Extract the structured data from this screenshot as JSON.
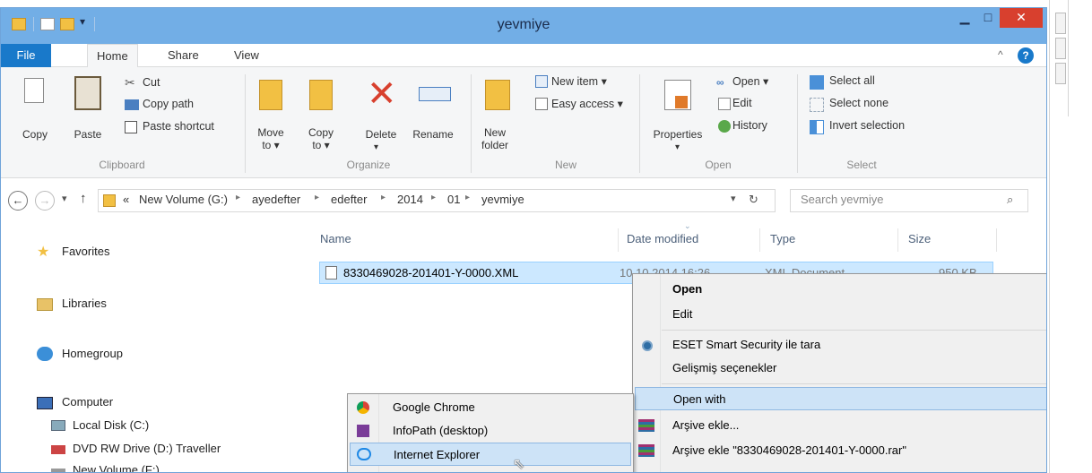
{
  "window": {
    "title": "yevmiye"
  },
  "tabs": [
    "File",
    "Home",
    "Share",
    "View"
  ],
  "ribbon": {
    "clipboard": {
      "group": "Clipboard",
      "copy": "Copy",
      "paste": "Paste",
      "cut": "Cut",
      "copy_path": "Copy path",
      "paste_shortcut": "Paste shortcut"
    },
    "organize": {
      "group": "Organize",
      "move_to_1": "Move",
      "move_to_2": "to ▾",
      "copy_to_1": "Copy",
      "copy_to_2": "to ▾",
      "delete": "Delete",
      "rename": "Rename"
    },
    "new": {
      "group": "New",
      "new_folder_1": "New",
      "new_folder_2": "folder",
      "new_item": "New item ▾",
      "easy_access": "Easy access ▾"
    },
    "open": {
      "group": "Open",
      "properties": "Properties",
      "open": "Open ▾",
      "edit": "Edit",
      "history": "History"
    },
    "select": {
      "group": "Select",
      "select_all": "Select all",
      "select_none": "Select none",
      "invert": "Invert selection"
    }
  },
  "address": {
    "prefix": "«",
    "crumbs": [
      "New Volume (G:)",
      "ayedefter",
      "edefter",
      "2014",
      "01",
      "yevmiye"
    ],
    "search_placeholder": "Search yevmiye"
  },
  "nav": [
    "Favorites",
    "Libraries",
    "Homegroup",
    "Computer",
    "Local Disk (C:)",
    "DVD RW Drive (D:) Traveller",
    "New Volume (F:)"
  ],
  "columns": [
    "Name",
    "Date modified",
    "Type",
    "Size"
  ],
  "file": {
    "name": "8330469028-201401-Y-0000.XML",
    "date": "10.10.2014 16:26",
    "type": "XML Document",
    "size": "950 KB"
  },
  "context_menu": [
    "Open",
    "Edit",
    "ESET Smart Security ile tara",
    "Gelişmiş seçenekler",
    "Open with",
    "Arşive ekle...",
    "Arşive ekle \"8330469028-201401-Y-0000.rar\""
  ],
  "open_with_menu": [
    "Google Chrome",
    "InfoPath (desktop)",
    "Internet Explorer"
  ],
  "colors": {
    "titlebar": "#72aee6",
    "file_tab": "#1979ca",
    "selection": "#cce8ff",
    "highlight": "#cde3f7"
  }
}
